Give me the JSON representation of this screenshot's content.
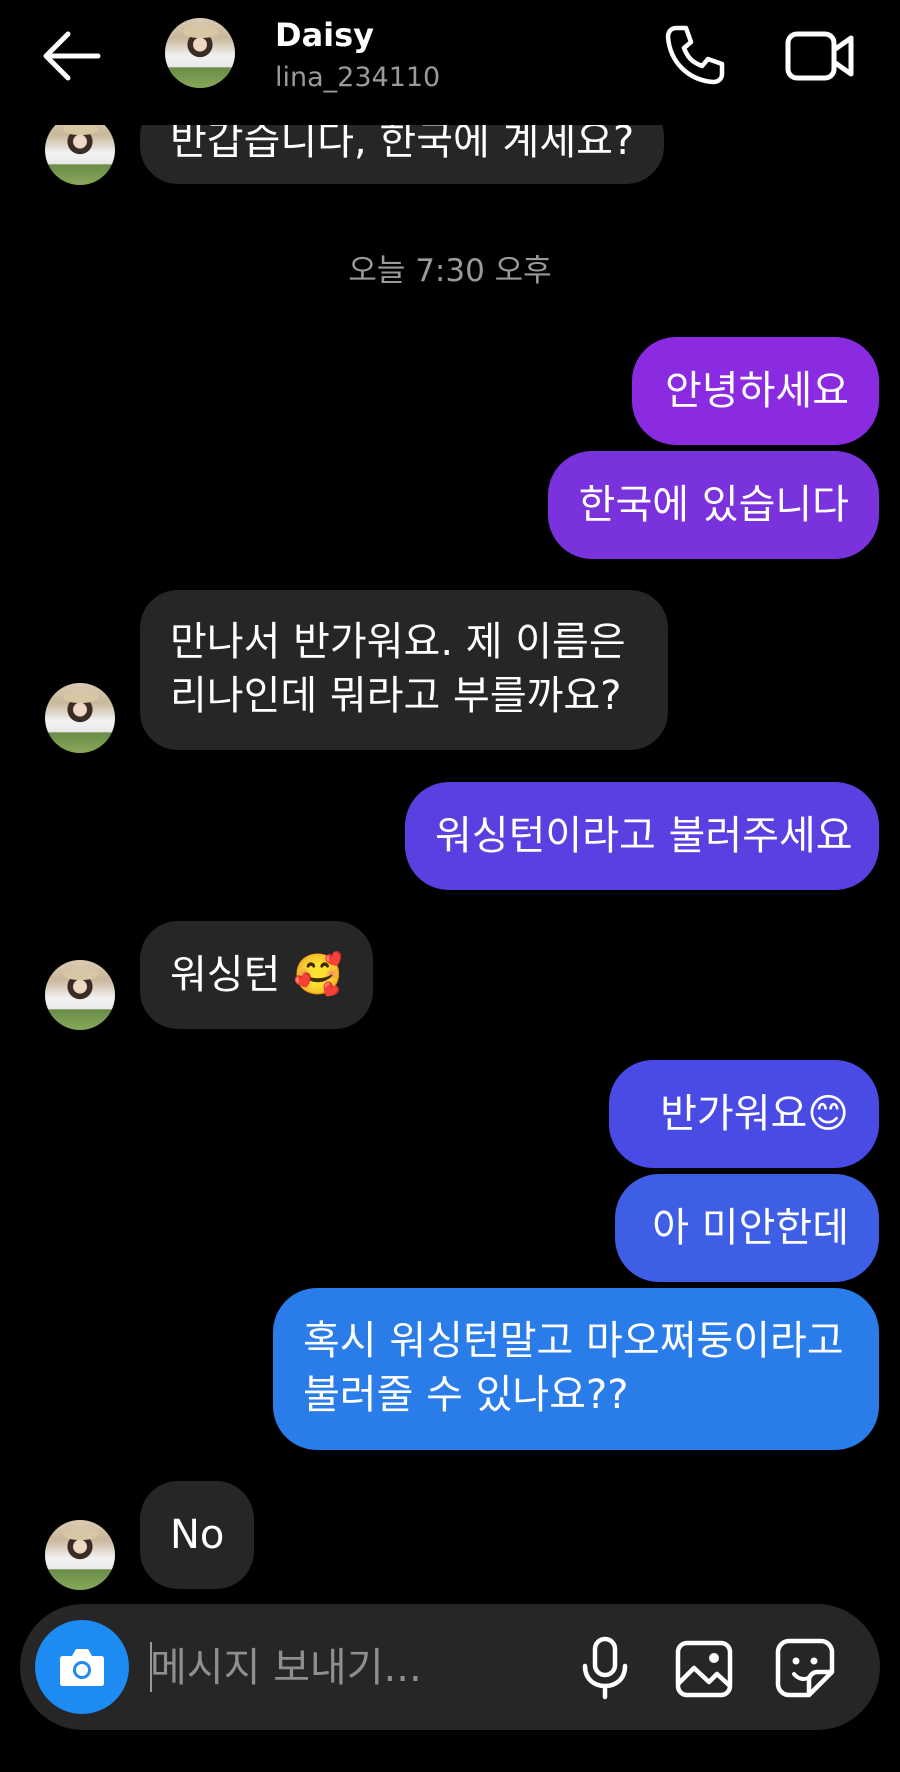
{
  "header": {
    "name": "Daisy",
    "handle": "lina_234110"
  },
  "timestamp": "오늘 7:30 오후",
  "messages": {
    "m0": "반갑습니다, 한국에 계세요?",
    "m1": "안녕하세요",
    "m2": "한국에 있습니다",
    "m3_l1": "만나서 반가워요. 제 이름은",
    "m3_l2": "리나인데 뭐라고 부를까요?",
    "m4": "워싱턴이라고 불러주세요",
    "m5": "워싱턴",
    "m5_emoji": "🥰",
    "m6": "반가워요",
    "m6_emoji": "😊",
    "m7": "아 미안한데",
    "m8_l1": "혹시 워싱턴말고 마오쩌둥이라고",
    "m8_l2": "불러줄 수 있나요??",
    "m9": "No"
  },
  "composer": {
    "placeholder": "메시지 보내기..."
  },
  "colors": {
    "sent_top": "#8a2be2",
    "sent_mid": "#5b3fe0",
    "sent_bottom": "#2a7de8",
    "received": "#262626",
    "camera_button": "#1d8bf1"
  }
}
